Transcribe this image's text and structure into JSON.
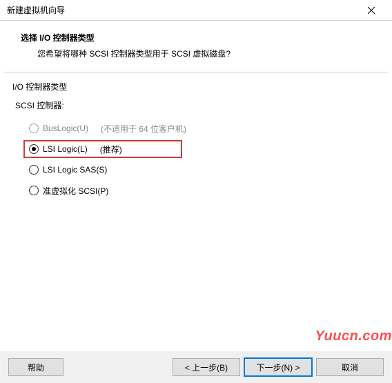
{
  "window": {
    "title": "新建虚拟机向导"
  },
  "header": {
    "title": "选择 I/O 控制器类型",
    "subtitle": "您希望将哪种 SCSI 控制器类型用于 SCSI 虚拟磁盘?"
  },
  "section": {
    "label": "I/O 控制器类型",
    "scsi_label": "SCSI 控制器:"
  },
  "options": {
    "buslogic": {
      "label": "BusLogic(U)",
      "hint": "(不适用于 64 位客户机)",
      "disabled": true,
      "selected": false
    },
    "lsilogic": {
      "label": "LSI Logic(L)",
      "hint": "(推荐)",
      "disabled": false,
      "selected": true
    },
    "lsisas": {
      "label": "LSI Logic SAS(S)",
      "hint": "",
      "disabled": false,
      "selected": false
    },
    "paravirt": {
      "label": "准虚拟化 SCSI(P)",
      "hint": "",
      "disabled": false,
      "selected": false
    }
  },
  "buttons": {
    "help": "帮助",
    "back": "< 上一步(B)",
    "next": "下一步(N) >",
    "cancel": "取消"
  },
  "watermark": "Yuucn.com"
}
